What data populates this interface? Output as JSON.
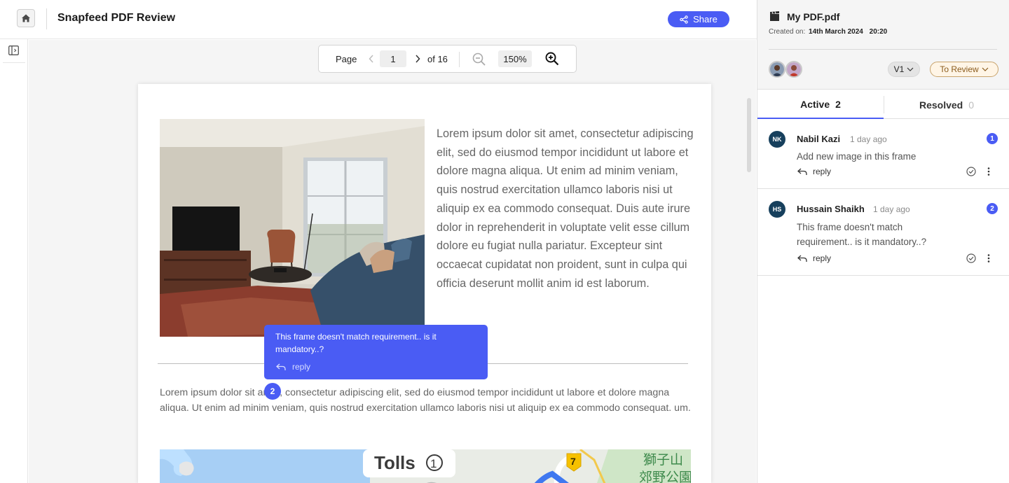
{
  "header": {
    "title": "Snapfeed PDF Review",
    "share_label": "Share"
  },
  "toolbar": {
    "page_label": "Page",
    "current_page": "1",
    "of_pages": "of 16",
    "zoom": "150%"
  },
  "document": {
    "paragraph1": "Lorem ipsum dolor sit amet, consectetur adipiscing elit, sed do eiusmod tempor incididunt ut labore et dolore magna aliqua. Ut enim ad minim veniam, quis nostrud exercitation ullamco laboris nisi ut aliquip ex ea commodo consequat. Duis aute irure dolor in reprehenderit in voluptate velit esse cillum dolore eu fugiat nulla pariatur. Excepteur sint occaecat cupidatat non proident, sunt in culpa qui officia deserunt mollit anim id est laborum.",
    "paragraph2": "Lorem ipsum dolor sit amet, consectetur adipiscing elit, sed do eiusmod tempor incididunt ut labore et dolore magna aliqua. Ut enim ad minim veniam, quis nostrud exercitation ullamco laboris nisi ut aliquip ex ea commodo consequat. um.",
    "map_labels": {
      "tolls": "Tolls",
      "tolls_count": "1",
      "route_badge": "7",
      "place_line1": "獅子山",
      "place_line2": "郊野公園"
    }
  },
  "popup": {
    "text": "This frame doesn't match requirement.. is it mandatory..?",
    "reply_label": "reply",
    "pin_number": "2"
  },
  "sidebar": {
    "file_name": "My PDF.pdf",
    "created_label": "Created on:",
    "created_date": "14th March 2024",
    "created_time": "20:20",
    "version": "V1",
    "status": "To Review",
    "tabs": [
      {
        "label": "Active",
        "count": "2"
      },
      {
        "label": "Resolved",
        "count": "0"
      }
    ],
    "comments": [
      {
        "initials": "NK",
        "name": "Nabil Kazi",
        "time": "1 day ago",
        "number": "1",
        "text": "Add new image in this frame",
        "reply_label": "reply"
      },
      {
        "initials": "HS",
        "name": "Hussain Shaikh",
        "time": "1 day ago",
        "number": "2",
        "text": "This frame doesn't match requirement.. is it mandatory..?",
        "reply_label": "reply"
      }
    ]
  },
  "colors": {
    "accent": "#4a5cf4",
    "status_border": "#c8a36c",
    "avatar_bg": "#17405d"
  },
  "icons": [
    "home-icon",
    "share-icon",
    "sidebar-toggle-icon",
    "chevron-left-icon",
    "chevron-right-icon",
    "zoom-out-icon",
    "zoom-in-icon",
    "film-icon",
    "chevron-down-icon",
    "reply-icon",
    "check-circle-icon",
    "more-vertical-icon"
  ]
}
